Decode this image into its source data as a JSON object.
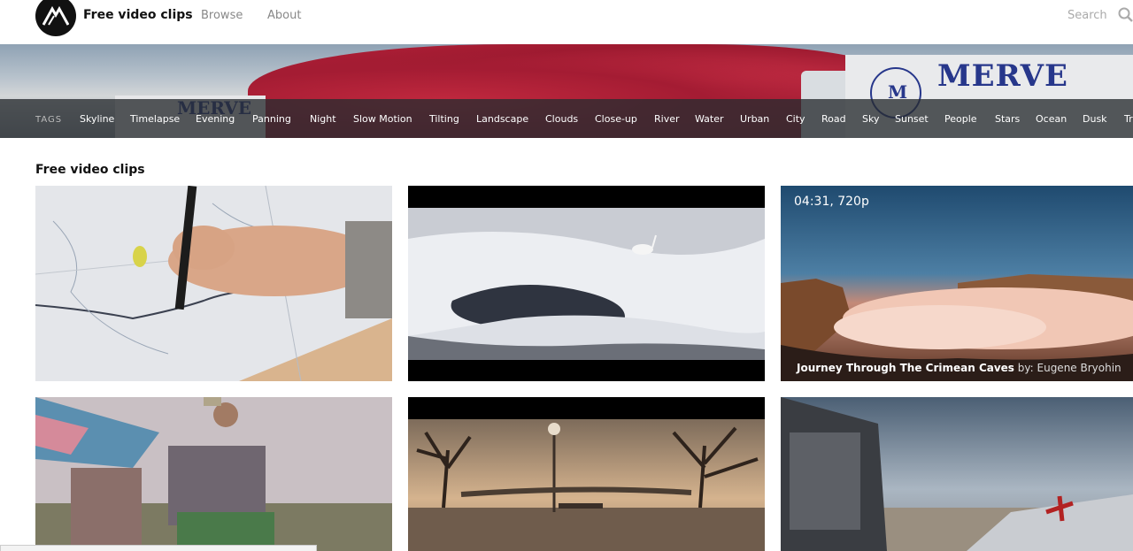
{
  "header": {
    "site_title": "Free video clips",
    "nav": [
      "Browse",
      "About"
    ],
    "search_placeholder": "Search"
  },
  "banner": {
    "truck_brand": "MERVE",
    "truck_emblem": "M"
  },
  "tags": {
    "label": "TAGS",
    "items": [
      "Skyline",
      "Timelapse",
      "Evening",
      "Panning",
      "Night",
      "Slow Motion",
      "Tilting",
      "Landscape",
      "Clouds",
      "Close-up",
      "River",
      "Water",
      "Urban",
      "City",
      "Road",
      "Sky",
      "Sunset",
      "People",
      "Stars",
      "Ocean",
      "Dusk",
      "Tr"
    ]
  },
  "main": {
    "section_title": "Free video clips",
    "clips": [
      {
        "scene": "hand-drawing-map"
      },
      {
        "scene": "swan-in-snow"
      },
      {
        "scene": "clouds-over-cliffs",
        "meta": "04:31, 720p",
        "title": "Journey Through The Crimean Caves",
        "by_label": "by:",
        "author": "Eugene Bryohin"
      },
      {
        "scene": "workers-market"
      },
      {
        "scene": "flooded-park"
      },
      {
        "scene": "plane-wreck"
      }
    ]
  },
  "colors": {
    "accent_text": "#111111",
    "muted_nav": "#888888",
    "tag_bar": "#2c3034",
    "banner_red": "#b62038",
    "truck_blue": "#27378b"
  },
  "icons": [
    "logo-icon",
    "search-icon"
  ]
}
